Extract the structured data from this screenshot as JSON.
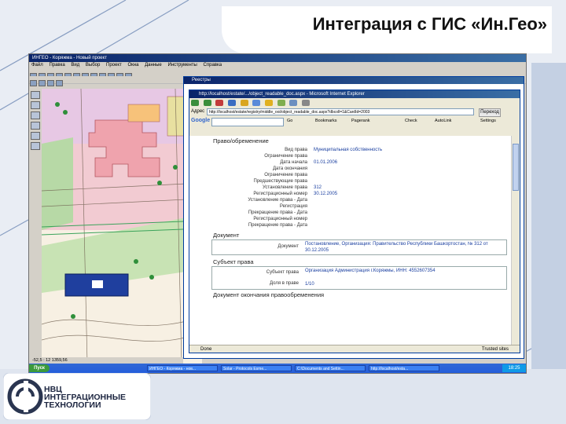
{
  "slide": {
    "title": "Интеграция с ГИС «Ин.Гео»"
  },
  "gis": {
    "window_title": "ИНГЕО - Коряжма - Новый проект",
    "menu": [
      "Файл",
      "Правка",
      "Вид",
      "Выбор",
      "Проект",
      "Окна",
      "Данные",
      "Инструменты",
      "Справка"
    ],
    "status": "-52,5 : 12 1359,56"
  },
  "registry_window": {
    "title": "Реестры"
  },
  "ie": {
    "title": "http://localhost/estate/.../object_readable_doc.aspx - Microsoft Internet Explorer",
    "address_label": "Адрес",
    "address": "http://localhost/estate/registry/middle_ooi/object_readable_doc.aspx?dbcoll=1&CardId=2003",
    "go_label": "Переход",
    "google": {
      "logo": "Google",
      "items": [
        "Go",
        "Bookmarks",
        "Pagerank",
        "Check",
        "AutoLink",
        "Settings"
      ]
    },
    "status_text": "Done",
    "status_zone": "Trusted sites"
  },
  "doc": {
    "section_rights": "Право/обременение",
    "rows": [
      {
        "label": "Вид права",
        "value": "Муниципальная собственность"
      },
      {
        "label": "Ограничение права",
        "value": ""
      },
      {
        "label": "Дата начала",
        "value": "01.01.2006"
      },
      {
        "label": "Дата окончания",
        "value": ""
      },
      {
        "label": "Ограничение права",
        "value": ""
      },
      {
        "label": "Предшествующие права",
        "value": ""
      },
      {
        "label": "Установление права",
        "value": "312"
      },
      {
        "label": "Регистрационный номер",
        "value": "30.12.2005"
      },
      {
        "label": "Установление права - Дата",
        "value": ""
      },
      {
        "label": "Регистрация",
        "value": ""
      },
      {
        "label": "Прекращение права - Дата",
        "value": ""
      },
      {
        "label": "Регистрационный номер",
        "value": ""
      },
      {
        "label": "Прекращение права - Дата",
        "value": ""
      }
    ],
    "section_document": "Документ",
    "document_label": "Документ",
    "document_value": "Постановление, Организация: Правительство Республики Башкортостан, № 312 от 30.12.2005",
    "section_subject": "Субъект права",
    "subject_label": "Субъект права",
    "subject_value": "Организация Администрация г.Коряжмы, ИНН: 4552607354",
    "share_label": "Доля в праве",
    "share_value": "1/10",
    "section_end": "Документ окончания правообременения"
  },
  "taskbar": {
    "start": "Пуск",
    "buttons": [
      "ИНГЕО - Коряжма - нов...",
      "Solar - Protocols Esme...",
      "C:\\Documents and Settin...",
      "http://localhost/esta..."
    ],
    "clock": "18:25"
  },
  "logo": {
    "line1": "НВЦ",
    "line2": "ИНТЕГРАЦИОННЫЕ",
    "line3": "ТЕХНОЛОГИИ"
  }
}
